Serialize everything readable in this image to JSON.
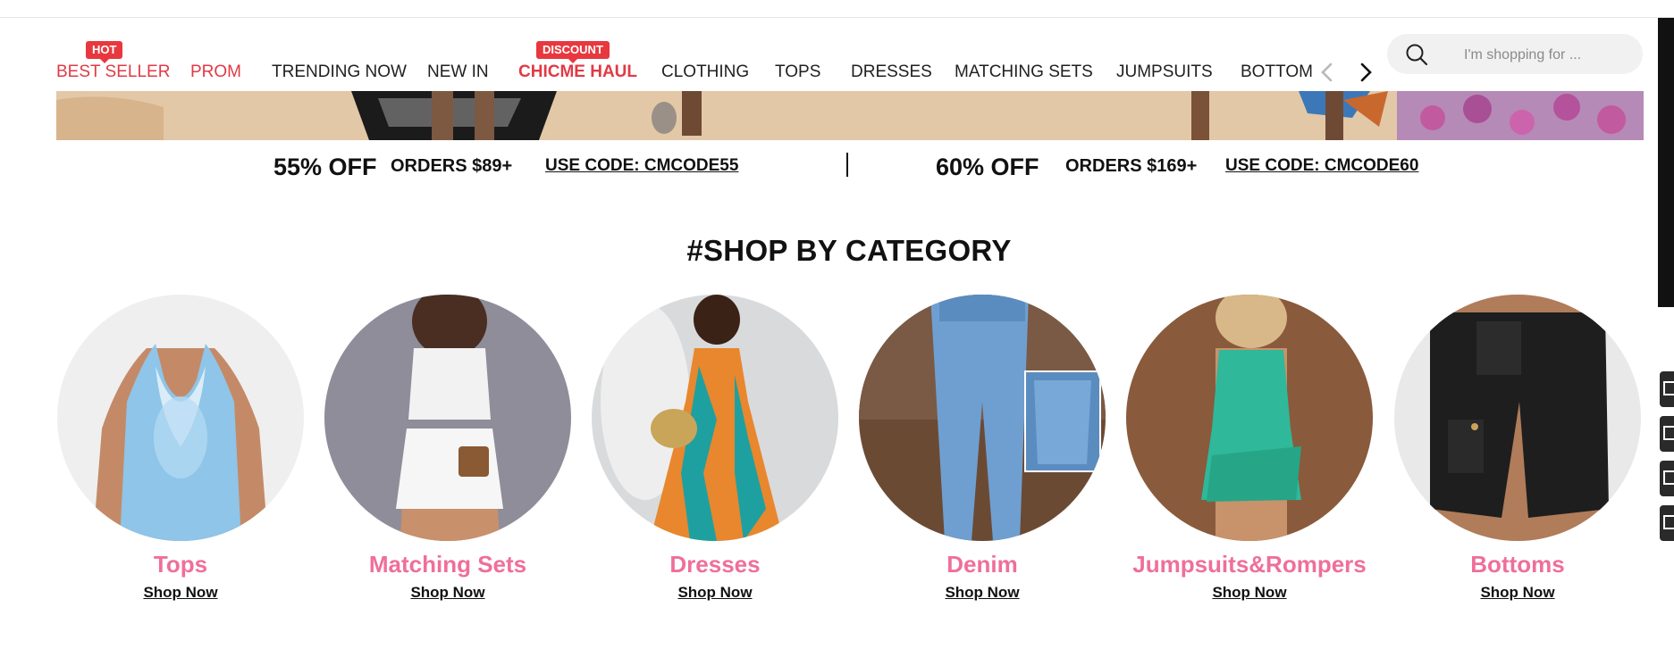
{
  "nav": {
    "items": [
      {
        "label": "BEST SELLER",
        "badge": "HOT"
      },
      {
        "label": "PROM"
      },
      {
        "label": "TRENDING NOW"
      },
      {
        "label": "NEW IN"
      },
      {
        "label": "CHICME HAUL",
        "badge": "DISCOUNT"
      },
      {
        "label": "CLOTHING"
      },
      {
        "label": "TOPS"
      },
      {
        "label": "DRESSES"
      },
      {
        "label": "MATCHING SETS"
      },
      {
        "label": "JUMPSUITS"
      },
      {
        "label": "BOTTOM"
      }
    ],
    "prev_icon": "chevron-left-icon",
    "next_icon": "chevron-right-icon"
  },
  "search": {
    "placeholder": "I'm shopping for ...",
    "icon": "search-icon"
  },
  "promos": [
    {
      "discount": "55% OFF",
      "condition": "ORDERS $89+",
      "code": "USE CODE: CMCODE55"
    },
    {
      "discount": "60% OFF",
      "condition": "ORDERS $169+",
      "code": "USE CODE: CMCODE60"
    }
  ],
  "section": {
    "title": "#SHOP BY CATEGORY"
  },
  "categories": [
    {
      "name": "Tops",
      "cta": "Shop Now"
    },
    {
      "name": "Matching Sets",
      "cta": "Shop Now"
    },
    {
      "name": "Dresses",
      "cta": "Shop Now"
    },
    {
      "name": "Denim",
      "cta": "Shop Now"
    },
    {
      "name": "Jumpsuits&Rompers",
      "cta": "Shop Now"
    },
    {
      "name": "Bottoms",
      "cta": "Shop Now"
    }
  ],
  "colors": {
    "accent_red": "#e03a45",
    "badge_red": "#e8383f",
    "category_pink": "#ef6f9a"
  }
}
